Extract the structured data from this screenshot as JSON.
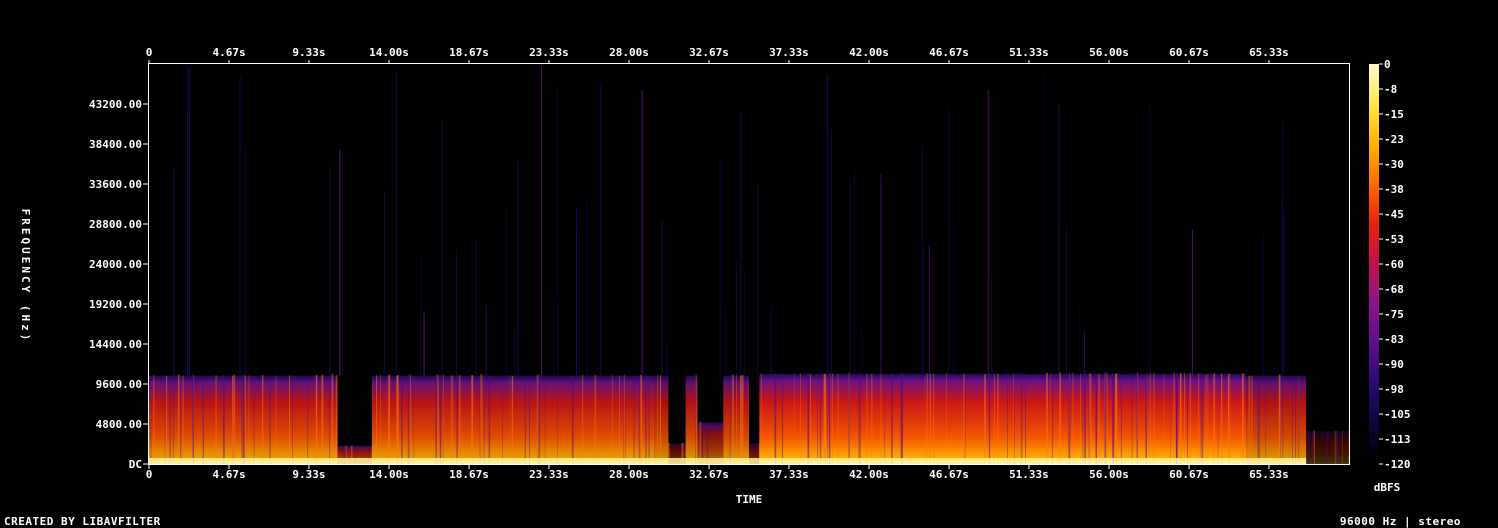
{
  "chart_data": {
    "type": "heatmap",
    "title": "",
    "xlabel": "TIME",
    "ylabel": "FREQUENCY (Hz)",
    "x_ticks": [
      "0",
      "4.67s",
      "9.33s",
      "14.00s",
      "18.67s",
      "23.33s",
      "28.00s",
      "32.67s",
      "37.33s",
      "42.00s",
      "46.67s",
      "51.33s",
      "56.00s",
      "60.67s",
      "65.33s"
    ],
    "x_tick_values": [
      0,
      4.67,
      9.33,
      14.0,
      18.67,
      23.33,
      28.0,
      32.67,
      37.33,
      42.0,
      46.67,
      51.33,
      56.0,
      60.67,
      65.33
    ],
    "xlim": [
      0,
      70
    ],
    "y_ticks": [
      "DC",
      "4800.00",
      "9600.00",
      "14400.00",
      "19200.00",
      "24000.00",
      "28800.00",
      "33600.00",
      "38400.00",
      "43200.00"
    ],
    "y_tick_values": [
      0,
      4800,
      9600,
      14400,
      19200,
      24000,
      28800,
      33600,
      38400,
      43200
    ],
    "ylim": [
      0,
      48000
    ],
    "colorbar": {
      "label": "dBFS",
      "ticks": [
        "0",
        "-8",
        "-15",
        "-23",
        "-30",
        "-38",
        "-45",
        "-53",
        "-60",
        "-68",
        "-75",
        "-83",
        "-90",
        "-98",
        "-105",
        "-113",
        "-120"
      ],
      "range": [
        -120,
        0
      ],
      "colormap": [
        "#000000",
        "#0a0638",
        "#2a0a70",
        "#5a0f8a",
        "#8a1488",
        "#c0124a",
        "#e8200c",
        "#ff6a00",
        "#ffb400",
        "#ffe84a",
        "#fffbd0"
      ]
    },
    "segments": [
      {
        "start": 0.0,
        "end": 11.0,
        "cutoff_hz": 10600,
        "level_dbfs": -45
      },
      {
        "start": 11.0,
        "end": 13.0,
        "cutoff_hz": 2200,
        "level_dbfs": -60
      },
      {
        "start": 13.0,
        "end": 29.5,
        "cutoff_hz": 10600,
        "level_dbfs": -45
      },
      {
        "start": 29.5,
        "end": 30.3,
        "cutoff_hz": 10600,
        "level_dbfs": -50
      },
      {
        "start": 30.3,
        "end": 31.3,
        "cutoff_hz": 2500,
        "level_dbfs": -75
      },
      {
        "start": 31.3,
        "end": 32.0,
        "cutoff_hz": 10600,
        "level_dbfs": -48
      },
      {
        "start": 32.0,
        "end": 33.5,
        "cutoff_hz": 5000,
        "level_dbfs": -60
      },
      {
        "start": 33.5,
        "end": 35.0,
        "cutoff_hz": 10600,
        "level_dbfs": -48
      },
      {
        "start": 35.0,
        "end": 35.6,
        "cutoff_hz": 2500,
        "level_dbfs": -75
      },
      {
        "start": 35.6,
        "end": 64.0,
        "cutoff_hz": 10800,
        "level_dbfs": -40
      },
      {
        "start": 64.0,
        "end": 67.5,
        "cutoff_hz": 10600,
        "level_dbfs": -48
      },
      {
        "start": 67.5,
        "end": 70.0,
        "cutoff_hz": 4000,
        "level_dbfs": -90
      }
    ]
  },
  "footer": {
    "left": "CREATED BY LIBAVFILTER",
    "right": "96000 Hz | stereo"
  }
}
